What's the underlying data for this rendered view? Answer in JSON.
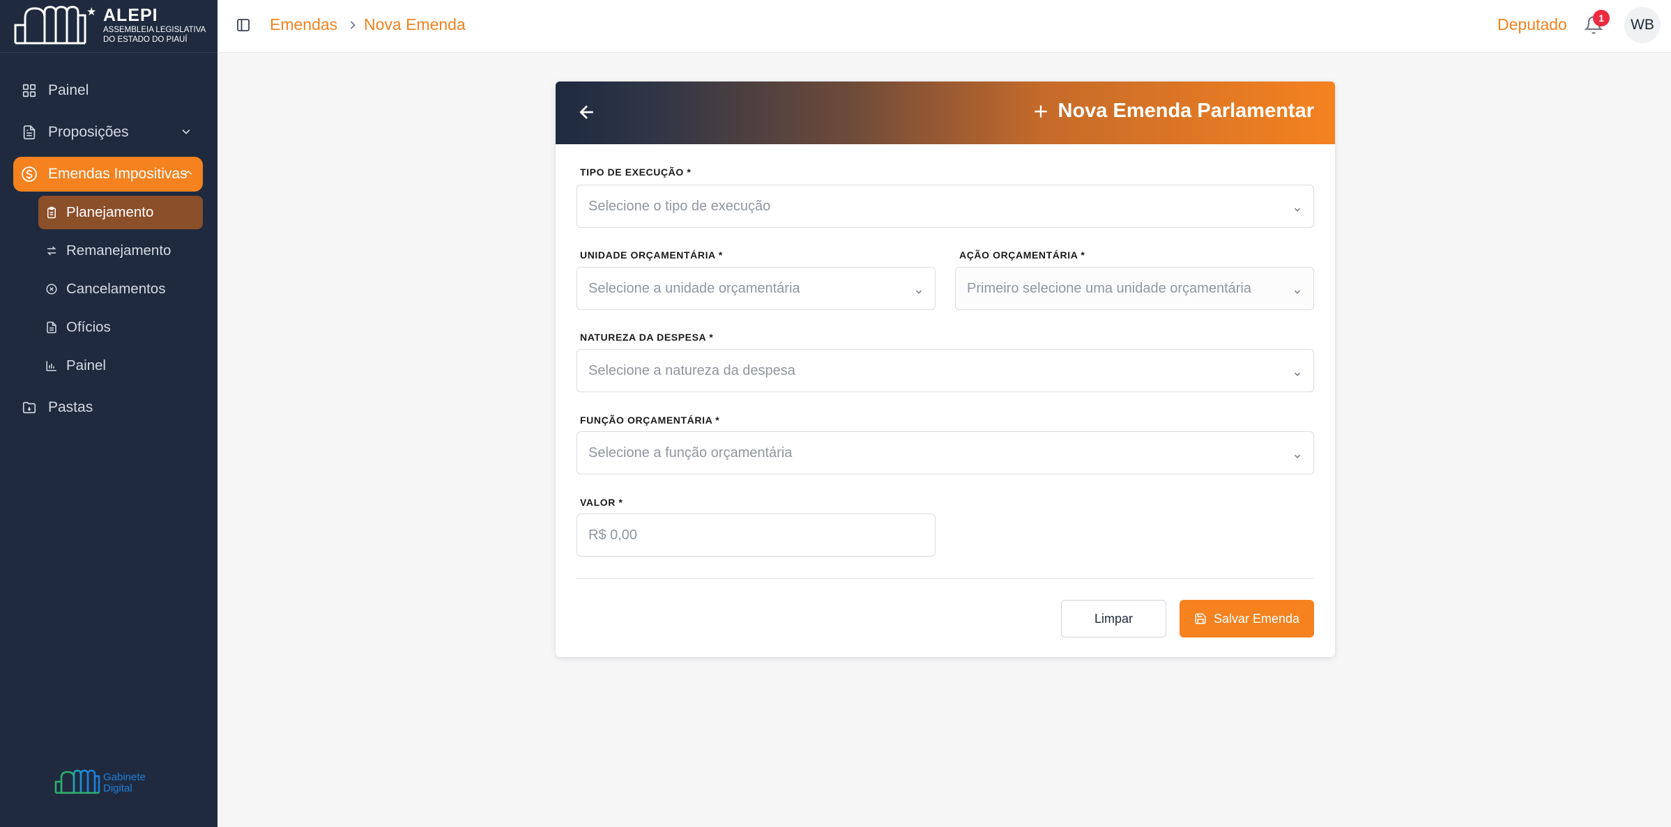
{
  "brand": {
    "name": "ALEPI",
    "subtitle_line1": "ASSEMBLEIA LEGISLATIVA",
    "subtitle_line2": "DO ESTADO DO PIAUÍ",
    "footer_logo_line1": "Gabinete",
    "footer_logo_line2": "Digital"
  },
  "sidebar": {
    "items": [
      {
        "label": "Painel",
        "icon": "grid-icon"
      },
      {
        "label": "Proposições",
        "icon": "file-text-icon"
      },
      {
        "label": "Emendas Impositivas",
        "icon": "dollar-circle-icon",
        "active": true
      },
      {
        "label": "Pastas",
        "icon": "folder-icon"
      }
    ],
    "subitems": [
      {
        "label": "Planejamento",
        "icon": "clipboard-icon",
        "active": true
      },
      {
        "label": "Remanejamento",
        "icon": "arrows-icon"
      },
      {
        "label": "Cancelamentos",
        "icon": "x-circle-icon"
      },
      {
        "label": "Ofícios",
        "icon": "file-icon"
      },
      {
        "label": "Painel",
        "icon": "bar-chart-icon"
      }
    ]
  },
  "header": {
    "breadcrumb": [
      "Emendas",
      "Nova Emenda"
    ],
    "role": "Deputado",
    "notification_count": "1",
    "avatar_initials": "WB"
  },
  "form": {
    "title": "Nova Emenda Parlamentar",
    "fields": {
      "tipo_execucao": {
        "label": "TIPO DE EXECUÇÃO *",
        "placeholder": "Selecione o tipo de execução"
      },
      "unidade_orcamentaria": {
        "label": "UNIDADE ORÇAMENTÁRIA *",
        "placeholder": "Selecione a unidade orçamentária"
      },
      "acao_orcamentaria": {
        "label": "AÇÃO ORÇAMENTÁRIA *",
        "placeholder": "Primeiro selecione uma unidade orçamentária"
      },
      "natureza_despesa": {
        "label": "NATUREZA DA DESPESA *",
        "placeholder": "Selecione a natureza da despesa"
      },
      "funcao_orcamentaria": {
        "label": "FUNÇÃO ORÇAMENTÁRIA *",
        "placeholder": "Selecione a função orçamentária"
      },
      "valor": {
        "label": "VALOR *",
        "placeholder": "R$ 0,00"
      }
    },
    "clear_label": "Limpar",
    "save_label": "Salvar Emenda"
  },
  "colors": {
    "accent": "#f5821f",
    "sidebar_bg": "#1f2a3f",
    "active_sub_bg": "#8b4f2a",
    "badge": "#ef2b3f"
  }
}
